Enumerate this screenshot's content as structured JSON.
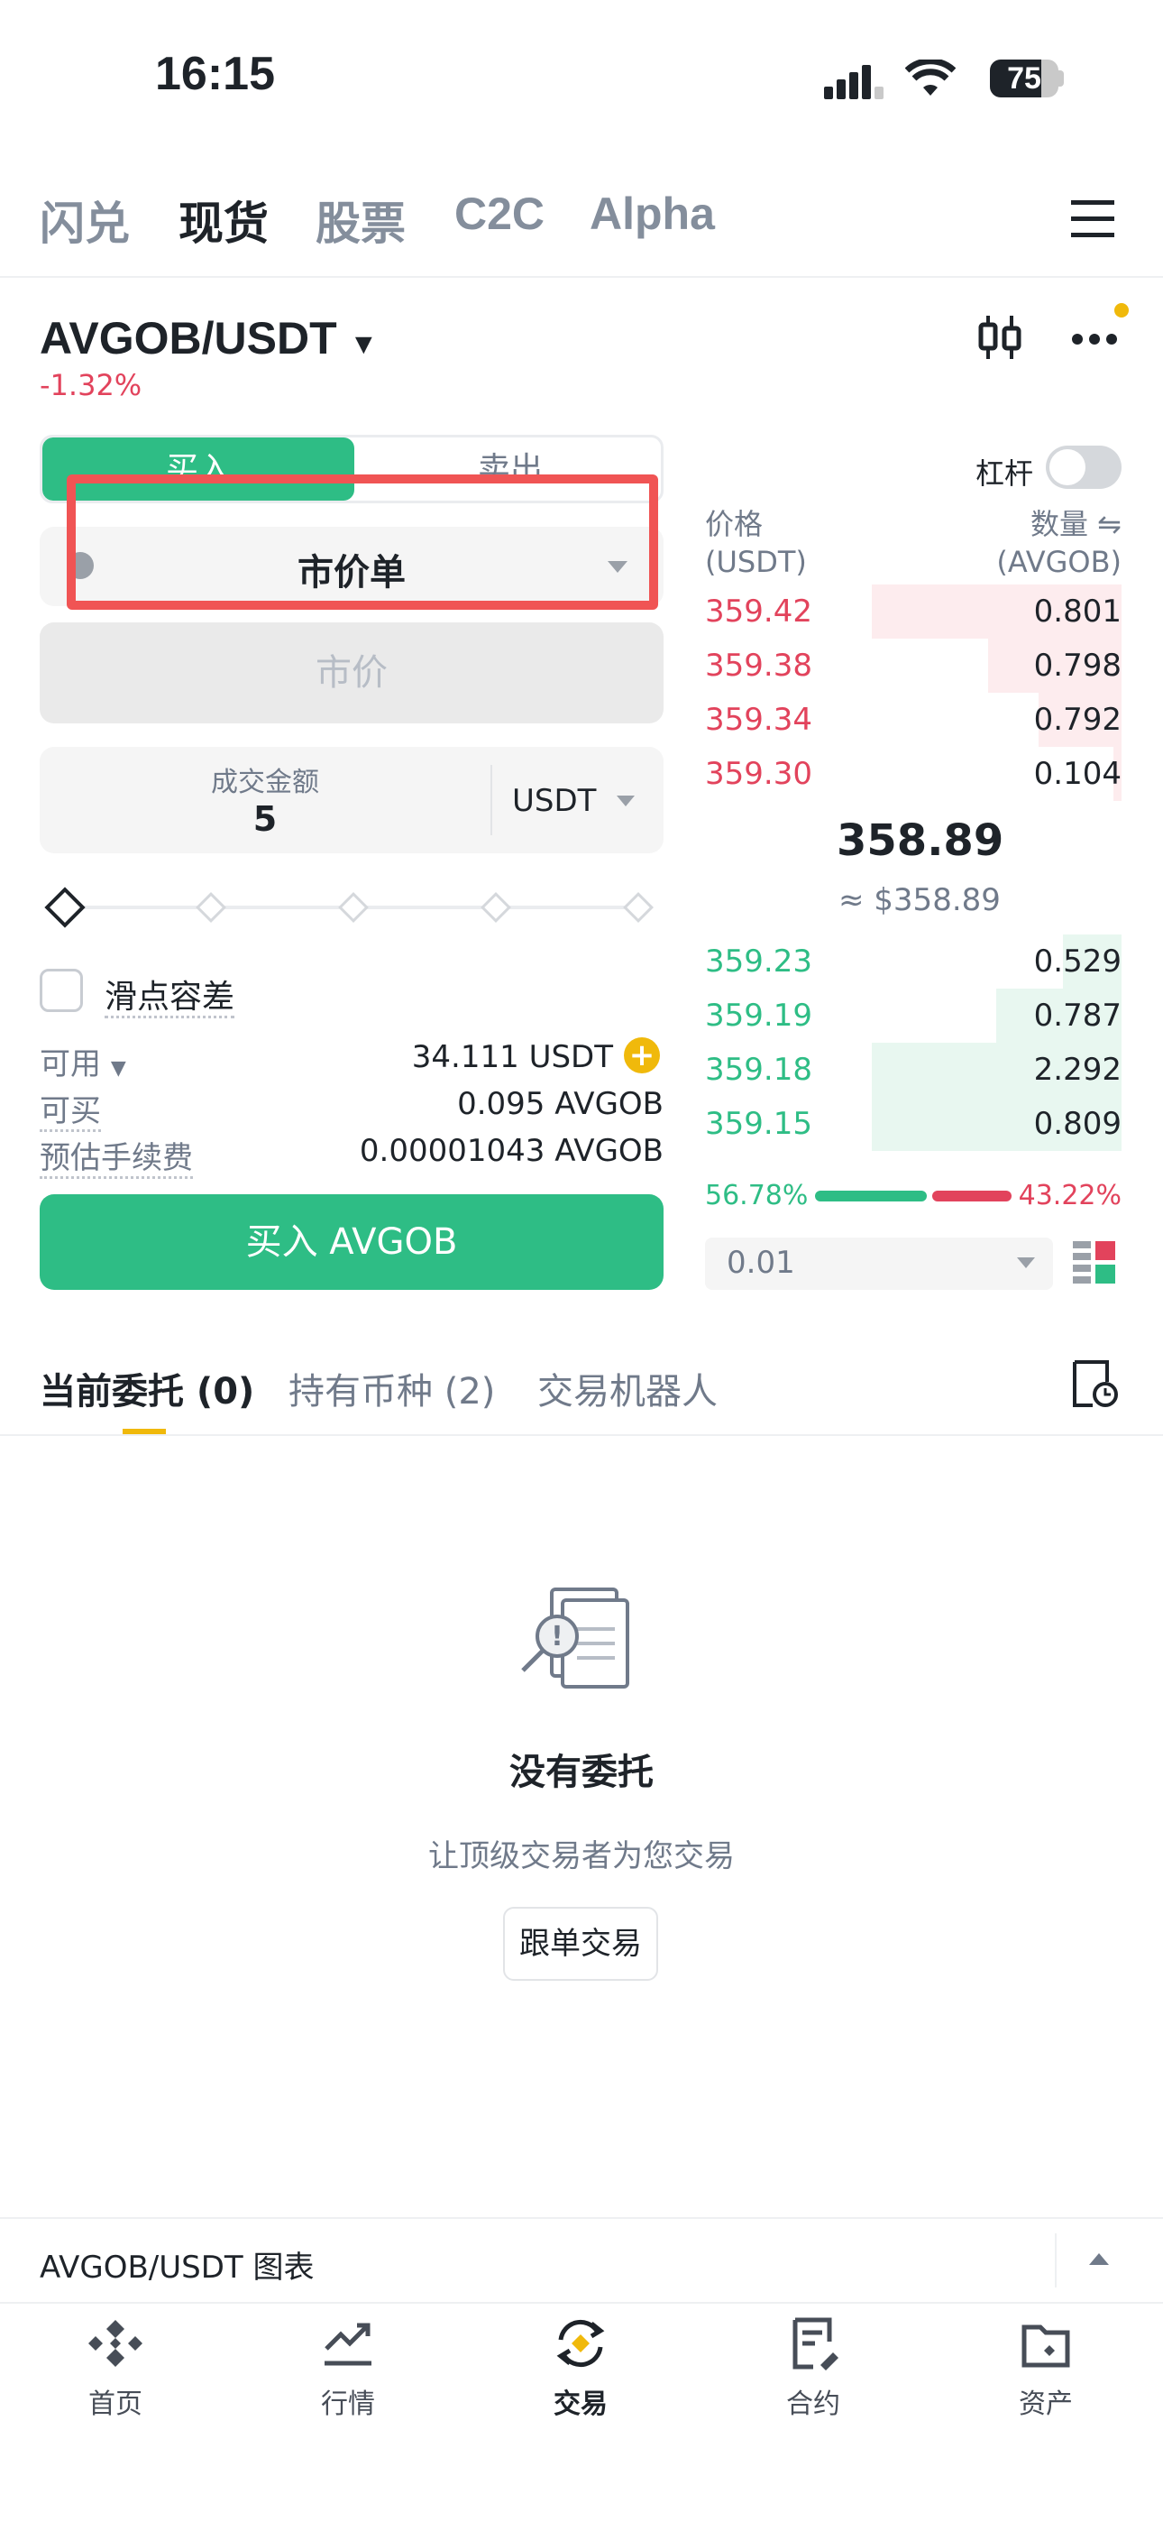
{
  "status_bar": {
    "time": "16:15",
    "battery": "75",
    "battery_level": 0.75
  },
  "top_tabs": [
    "闪兑",
    "现货",
    "股票",
    "C2C",
    "Alpha"
  ],
  "pair": {
    "name": "AVGOB/USDT",
    "change": "-1.32%"
  },
  "order_form": {
    "buy_label": "买入",
    "sell_label": "卖出",
    "order_type": "市价单",
    "price_placeholder": "市价",
    "amount_label": "成交金额",
    "amount_value": "5",
    "amount_unit": "USDT",
    "slider_percent": 0,
    "slippage_label": "滑点容差",
    "available_label": "可用",
    "available_value": "34.111 USDT",
    "max_buy_label": "可买",
    "max_buy_value": "0.095 AVGOB",
    "fee_label": "预估手续费",
    "fee_value": "0.00001043 AVGOB",
    "submit_label": "买入 AVGOB"
  },
  "orderbook": {
    "leverage_label": "杠杆",
    "price_header": "价格",
    "price_unit": "(USDT)",
    "qty_header": "数量 ⇋",
    "qty_unit": "(AVGOB)",
    "asks": [
      {
        "price": "359.42",
        "qty": "0.801",
        "depth": 0.6
      },
      {
        "price": "359.38",
        "qty": "0.798",
        "depth": 0.32
      },
      {
        "price": "359.34",
        "qty": "0.792",
        "depth": 0.2
      },
      {
        "price": "359.30",
        "qty": "0.104",
        "depth": 0.02
      }
    ],
    "last_price": "358.89",
    "last_price_usd": "≈ $358.89",
    "bids": [
      {
        "price": "359.23",
        "qty": "0.529",
        "depth": 0.14
      },
      {
        "price": "359.19",
        "qty": "0.787",
        "depth": 0.3
      },
      {
        "price": "359.18",
        "qty": "2.292",
        "depth": 0.6
      },
      {
        "price": "359.15",
        "qty": "0.809",
        "depth": 0.6
      }
    ],
    "buy_ratio": "56.78%",
    "sell_ratio": "43.22%",
    "buy_ratio_value": 56.78,
    "depth_value": "0.01"
  },
  "bottom_tabs": {
    "open_orders": "当前委托 (0)",
    "holdings": "持有币种 (2)",
    "bots": "交易机器人"
  },
  "empty_state": {
    "title": "没有委托",
    "subtitle": "让顶级交易者为您交易",
    "button": "跟单交易"
  },
  "chart_bar": {
    "label": "AVGOB/USDT 图表"
  },
  "nav": [
    "首页",
    "行情",
    "交易",
    "合约",
    "资产"
  ],
  "colors": {
    "green": "#2ebd85",
    "red": "#e2435c",
    "yellow": "#f0b90b",
    "highlight": "#f05454"
  }
}
